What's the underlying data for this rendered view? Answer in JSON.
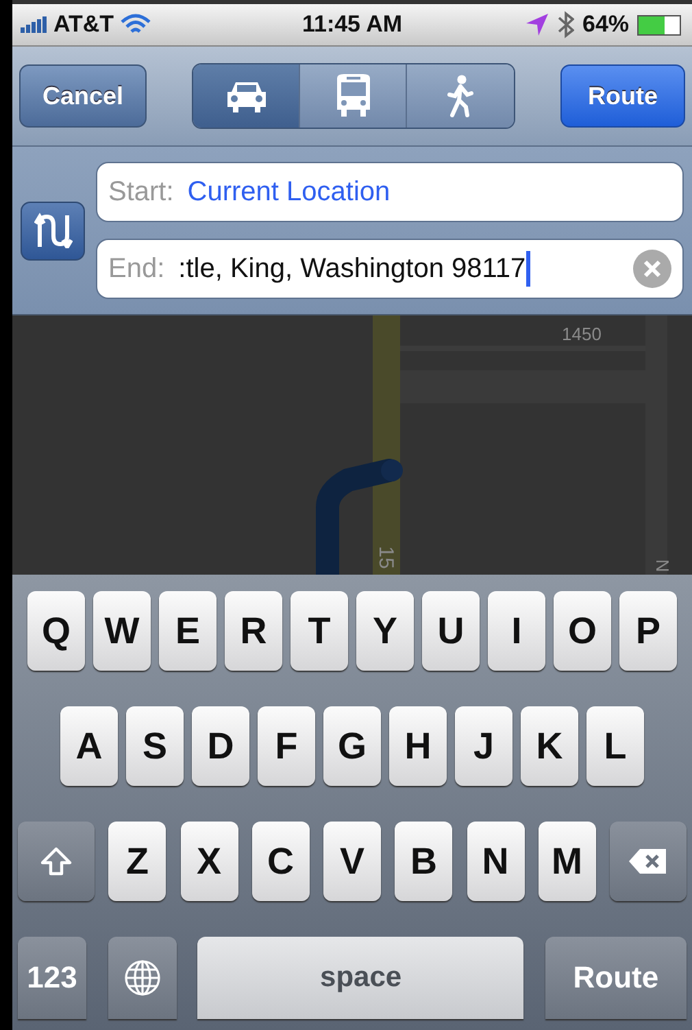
{
  "status_bar": {
    "carrier": "AT&T",
    "time": "11:45 AM",
    "battery": "64%"
  },
  "toolbar": {
    "cancel": "Cancel",
    "modes": [
      {
        "kind": "car",
        "selected": true
      },
      {
        "kind": "bus",
        "selected": false
      },
      {
        "kind": "walk",
        "selected": false
      }
    ],
    "route": "Route"
  },
  "fields": [
    {
      "label": "Start:",
      "value": "Current Location",
      "kind": "location",
      "clear": false
    },
    {
      "label": "End:",
      "value": ":tle, King, Washington 98117",
      "kind": "text",
      "clear": true
    }
  ],
  "map": {
    "labels": [
      {
        "text": "1450",
        "kind": "horizontal"
      },
      {
        "text": "15",
        "kind": "vertical"
      },
      {
        "text": "N",
        "kind": "edge"
      }
    ]
  },
  "keyboard": {
    "letter_rows": [
      [
        {
          "kind": "letter",
          "label": "Q"
        },
        {
          "kind": "letter",
          "label": "W"
        },
        {
          "kind": "letter",
          "label": "E"
        },
        {
          "kind": "letter",
          "label": "R"
        },
        {
          "kind": "letter",
          "label": "T"
        },
        {
          "kind": "letter",
          "label": "Y"
        },
        {
          "kind": "letter",
          "label": "U"
        },
        {
          "kind": "letter",
          "label": "I"
        },
        {
          "kind": "letter",
          "label": "O"
        },
        {
          "kind": "letter",
          "label": "P"
        }
      ],
      [
        {
          "kind": "letter",
          "label": "A"
        },
        {
          "kind": "letter",
          "label": "S"
        },
        {
          "kind": "letter",
          "label": "D"
        },
        {
          "kind": "letter",
          "label": "F"
        },
        {
          "kind": "letter",
          "label": "G"
        },
        {
          "kind": "letter",
          "label": "H"
        },
        {
          "kind": "letter",
          "label": "J"
        },
        {
          "kind": "letter",
          "label": "K"
        },
        {
          "kind": "letter",
          "label": "L"
        }
      ],
      [
        {
          "kind": "shift"
        },
        {
          "kind": "letter",
          "label": "Z"
        },
        {
          "kind": "letter",
          "label": "X"
        },
        {
          "kind": "letter",
          "label": "C"
        },
        {
          "kind": "letter",
          "label": "V"
        },
        {
          "kind": "letter",
          "label": "B"
        },
        {
          "kind": "letter",
          "label": "N"
        },
        {
          "kind": "letter",
          "label": "M"
        },
        {
          "kind": "delete"
        }
      ]
    ],
    "bottom_bar": {
      "numbers": "123",
      "space": "space",
      "return": "Route"
    }
  }
}
